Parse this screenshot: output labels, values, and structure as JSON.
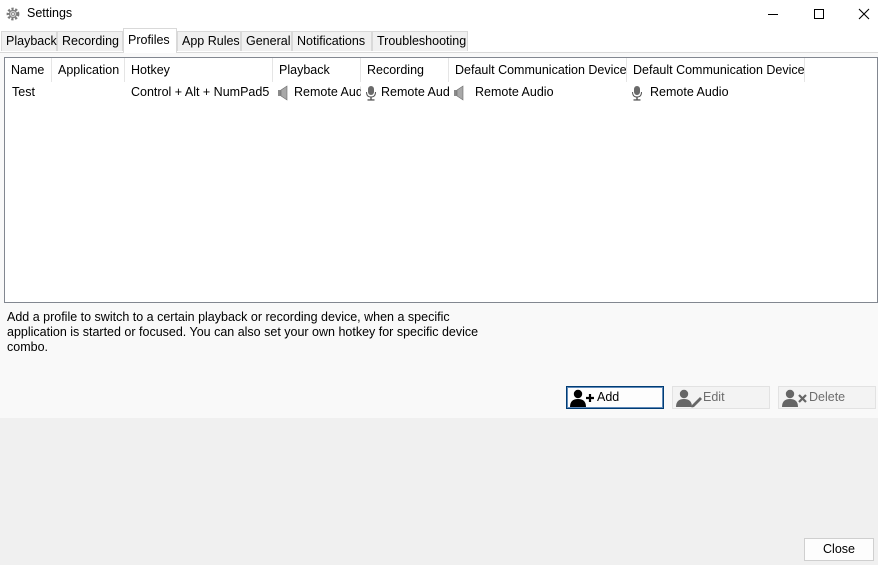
{
  "window": {
    "title": "Settings",
    "minimize_icon": "minimize-icon",
    "maximize_icon": "maximize-icon",
    "close_icon": "close-icon"
  },
  "tabs": [
    {
      "label": "Playback"
    },
    {
      "label": "Recording"
    },
    {
      "label": "Profiles"
    },
    {
      "label": "App Rules"
    },
    {
      "label": "General"
    },
    {
      "label": "Notifications"
    },
    {
      "label": "Troubleshooting"
    }
  ],
  "active_tab": "Profiles",
  "table": {
    "columns": [
      "Name",
      "Application",
      "Hotkey",
      "Playback",
      "Recording",
      "Default Communication Device",
      "Default Communication Device"
    ],
    "rows": [
      {
        "name": "Test",
        "application": "",
        "hotkey": "Control + Alt + NumPad5",
        "playback": "Remote Audio",
        "recording": "Remote Audio",
        "default_comm_playback": "Remote Audio",
        "default_comm_recording": "Remote Audio"
      }
    ]
  },
  "description": "Add a profile to switch to a certain playback or recording device, when a specific application is started or focused. You can also set your own hotkey for specific device combo.",
  "buttons": {
    "add": "Add",
    "edit": "Edit",
    "delete": "Delete",
    "close": "Close"
  },
  "colors": {
    "primary_border": "#003c74",
    "list_border": "#828790"
  }
}
